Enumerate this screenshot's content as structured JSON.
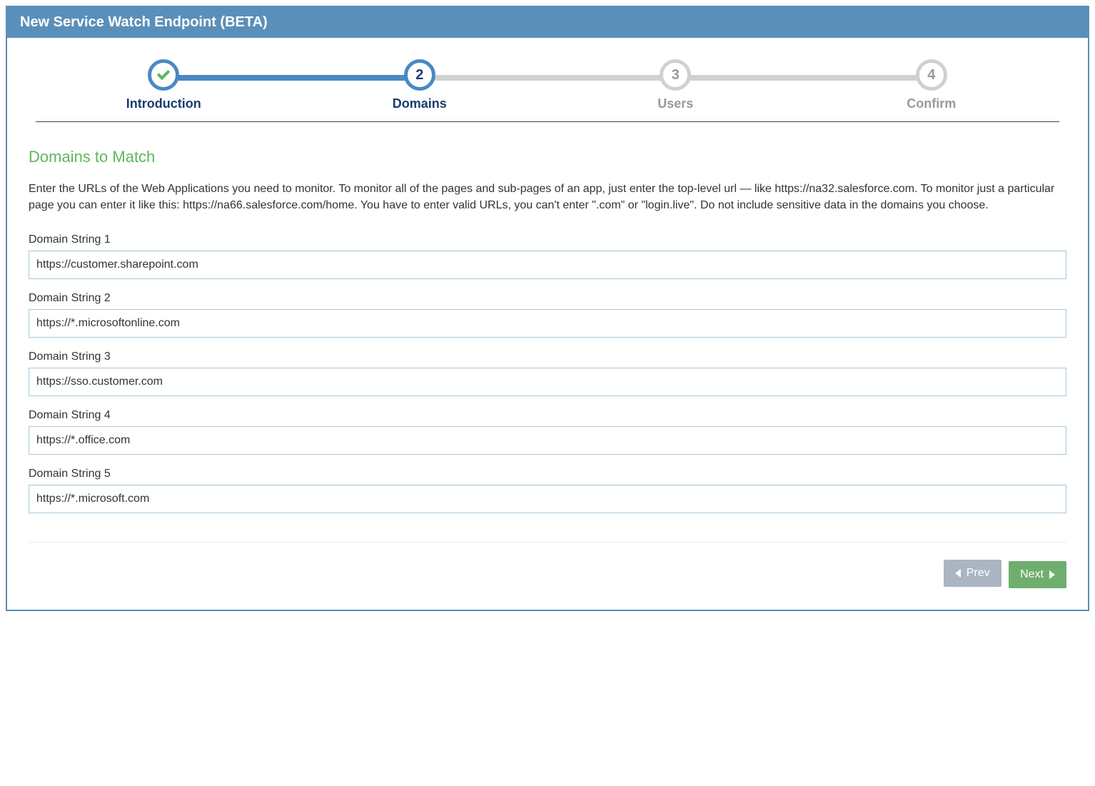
{
  "header": {
    "title": "New Service Watch Endpoint (BETA)"
  },
  "wizard": {
    "steps": [
      {
        "label": "Introduction",
        "marker": "check",
        "state": "completed"
      },
      {
        "label": "Domains",
        "marker": "2",
        "state": "active"
      },
      {
        "label": "Users",
        "marker": "3",
        "state": "pending"
      },
      {
        "label": "Confirm",
        "marker": "4",
        "state": "pending"
      }
    ]
  },
  "section": {
    "title": "Domains to Match",
    "instructions": "Enter the URLs of the Web Applications you need to monitor. To monitor all of the pages and sub-pages of an app, just enter the top-level url — like https://na32.salesforce.com. To monitor just a particular page you can enter it like this: https://na66.salesforce.com/home. You have to enter valid URLs, you can't enter \".com\" or \"login.live\". Do not include sensitive data in the domains you choose."
  },
  "domains": [
    {
      "label": "Domain String 1",
      "value": "https://customer.sharepoint.com"
    },
    {
      "label": "Domain String 2",
      "value": "https://*.microsoftonline.com"
    },
    {
      "label": "Domain String 3",
      "value": "https://sso.customer.com"
    },
    {
      "label": "Domain String 4",
      "value": "https://*.office.com"
    },
    {
      "label": "Domain String 5",
      "value": "https://*.microsoft.com"
    }
  ],
  "footer": {
    "prev": "Prev",
    "next": "Next"
  }
}
